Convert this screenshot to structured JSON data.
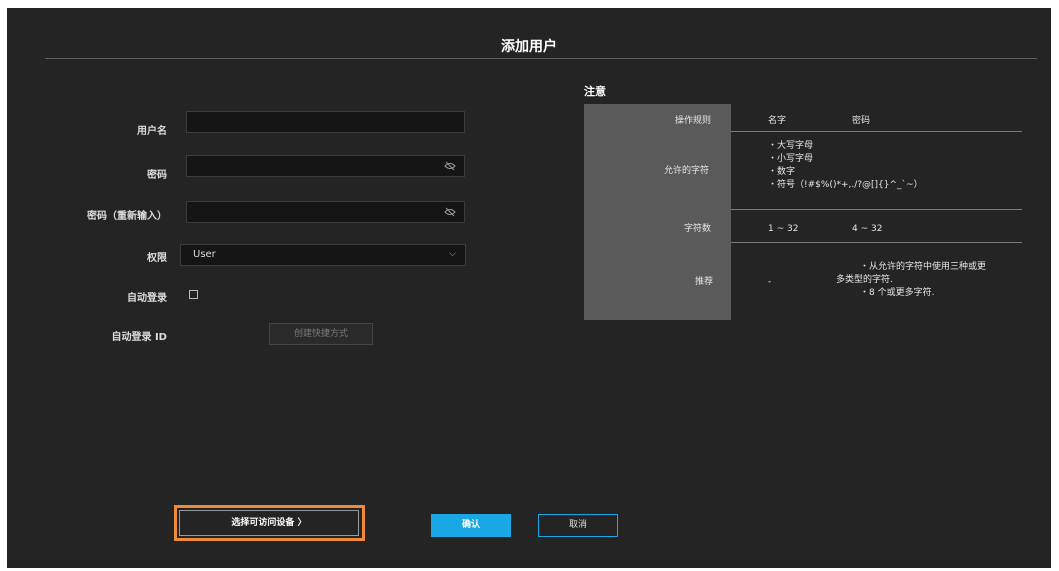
{
  "dialog": {
    "title": "添加用户"
  },
  "form": {
    "username_label": "用户名",
    "password_label": "密码",
    "password_confirm_label": "密码（重新输入）",
    "permission_label": "权限",
    "permission_value": "User",
    "auto_login_label": "自动登录",
    "auto_login_id_label": "自动登录 ID",
    "create_shortcut_label": "创建快捷方式"
  },
  "notes": {
    "title": "注意",
    "headers": {
      "rule": "操作规则",
      "name": "名字",
      "password": "密码"
    },
    "rows": {
      "allowed": {
        "label": "允许的字符",
        "items": [
          "・大写字母",
          "・小写字母",
          "・数字",
          "・符号（!#$%()*+,./?@[]{}^_`~）"
        ]
      },
      "count": {
        "label": "字符数",
        "name": "1 ~ 32",
        "password": "4 ~ 32"
      },
      "recommend": {
        "label": "推荐",
        "name": "-",
        "password_lines": [
          "・从允许的字符中使用三种或更",
          "多类型的字符.",
          "・8 个或更多字符."
        ]
      }
    }
  },
  "footer": {
    "select_devices_label": "选择可访问设备 〉",
    "confirm_label": "确认",
    "cancel_label": "取消"
  },
  "colors": {
    "accent": "#1aa7e6",
    "highlight": "#ef8b37",
    "panel_bg": "#242424"
  },
  "icons": {
    "password_toggle": "eye-slash-icon",
    "dropdown": "chevron-down-icon"
  }
}
